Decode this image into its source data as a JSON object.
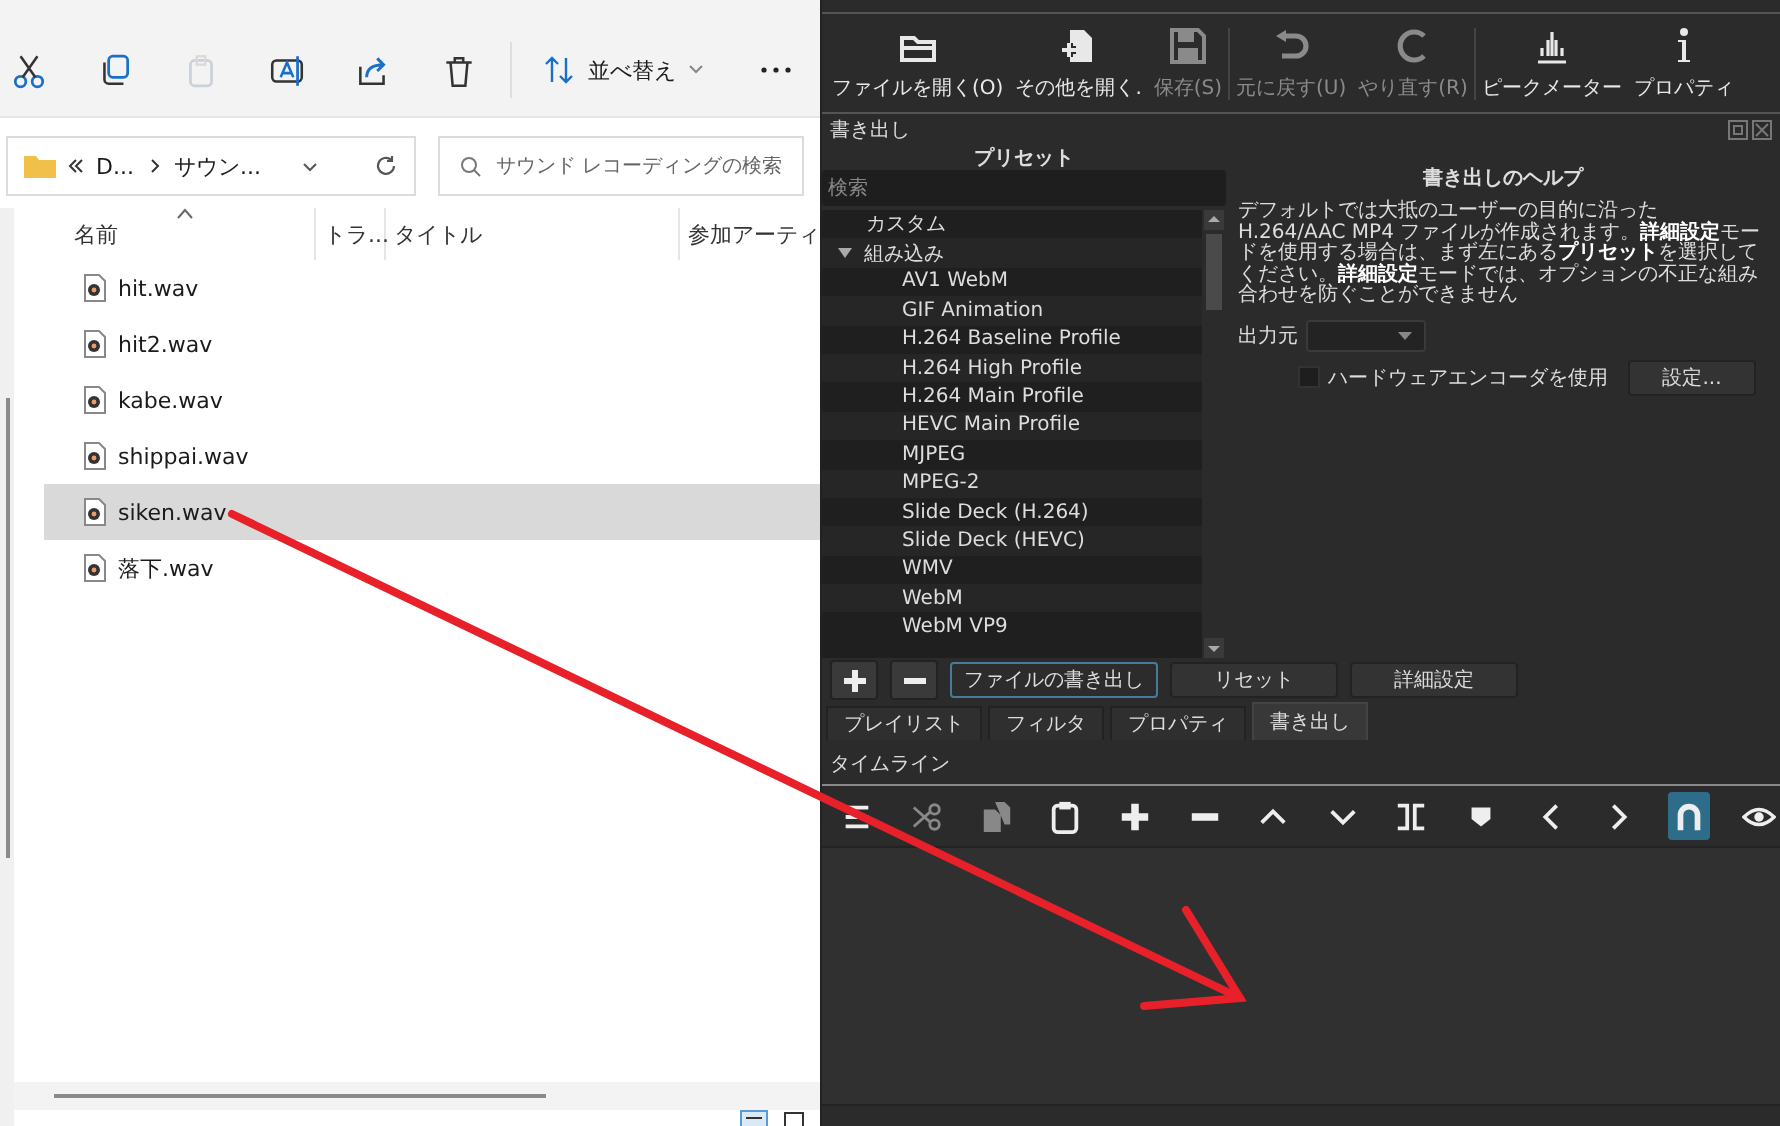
{
  "explorer": {
    "toolbar": [
      {
        "disabled": false
      },
      {
        "disabled": false
      },
      {
        "disabled": true
      },
      {
        "disabled": false
      },
      {
        "disabled": false
      },
      {
        "disabled": false
      }
    ],
    "sort_button": {
      "label": "並べ替え"
    },
    "address": {
      "crumbs": [
        "D...",
        "サウン..."
      ]
    },
    "search": {
      "placeholder": "サウンド レコーディングの検索"
    },
    "columns": [
      "名前",
      "トラ...",
      "タイトル",
      "参加アーティ"
    ],
    "files": [
      {
        "name": "hit.wav",
        "selected": false
      },
      {
        "name": "hit2.wav",
        "selected": false
      },
      {
        "name": "kabe.wav",
        "selected": false
      },
      {
        "name": "shippai.wav",
        "selected": false
      },
      {
        "name": "siken.wav",
        "selected": true
      },
      {
        "name": "落下.wav",
        "selected": false
      }
    ]
  },
  "editor": {
    "toolbar": [
      {
        "kind": "open",
        "label": "ファイルを開く(O)",
        "disabled": false
      },
      {
        "kind": "open-other",
        "label": "その他を開く.",
        "disabled": false
      },
      {
        "kind": "save",
        "label": "保存(S)",
        "disabled": true
      },
      {
        "kind": "undo",
        "label": "元に戻す(U)",
        "disabled": true
      },
      {
        "kind": "redo",
        "label": "やり直す(R)",
        "disabled": true
      },
      {
        "kind": "meter",
        "label": "ピークメーター",
        "disabled": false
      },
      {
        "kind": "info",
        "label": "プロパティ",
        "disabled": false
      }
    ],
    "export_panel": {
      "title": "書き出し",
      "presets_heading": "プリセット",
      "search_placeholder": "検索",
      "presets": [
        {
          "label": "カスタム"
        },
        {
          "label": "組み込み",
          "expanded": true,
          "children": [
            {
              "label": "AV1 WebM"
            },
            {
              "label": "GIF Animation"
            },
            {
              "label": "H.264 Baseline Profile"
            },
            {
              "label": "H.264 High Profile"
            },
            {
              "label": "H.264 Main Profile"
            },
            {
              "label": "HEVC Main Profile"
            },
            {
              "label": "MJPEG"
            },
            {
              "label": "MPEG-2"
            },
            {
              "label": "Slide Deck (H.264)"
            },
            {
              "label": "Slide Deck (HEVC)"
            },
            {
              "label": "WMV"
            },
            {
              "label": "WebM"
            },
            {
              "label": "WebM VP9"
            }
          ]
        }
      ],
      "help_heading": "書き出しのヘルプ",
      "help_text": "デフォルトでは大抵のユーザーの目的に沿った H.264/AAC MP4 ファイルが作成されます。**詳細設定**モードを使用する場合は、まず左にある**プリセット**を選択してください。**詳細設定**モードでは、オプションの不正な組み合わせを防ぐことができません",
      "source_label": "出力元",
      "hardware_encoder": {
        "label": "ハードウェアエンコーダを使用",
        "checked": false
      },
      "settings_button": "設定...",
      "action_buttons": [
        {
          "label": "ファイルの書き出し",
          "focused": true
        },
        {
          "label": "リセット",
          "focused": false
        },
        {
          "label": "詳細設定",
          "focused": false
        }
      ]
    },
    "tabs": [
      {
        "label": "プレイリスト",
        "selected": false
      },
      {
        "label": "フィルタ",
        "selected": false
      },
      {
        "label": "プロパティ",
        "selected": false
      },
      {
        "label": "書き出し",
        "selected": true
      }
    ],
    "timeline": {
      "title": "タイムライン",
      "tools": [
        {
          "disabled": false,
          "on": false
        },
        {
          "disabled": true,
          "on": false
        },
        {
          "disabled": true,
          "on": false
        },
        {
          "disabled": false,
          "on": false
        },
        {
          "disabled": false,
          "on": false
        },
        {
          "disabled": false,
          "on": false
        },
        {
          "disabled": false,
          "on": false
        },
        {
          "disabled": false,
          "on": false
        },
        {
          "disabled": false,
          "on": false
        },
        {
          "disabled": false,
          "on": false
        },
        {
          "disabled": false,
          "on": false
        },
        {
          "disabled": false,
          "on": false
        },
        {
          "disabled": false,
          "on": true
        },
        {
          "disabled": false,
          "on": false
        }
      ]
    }
  }
}
